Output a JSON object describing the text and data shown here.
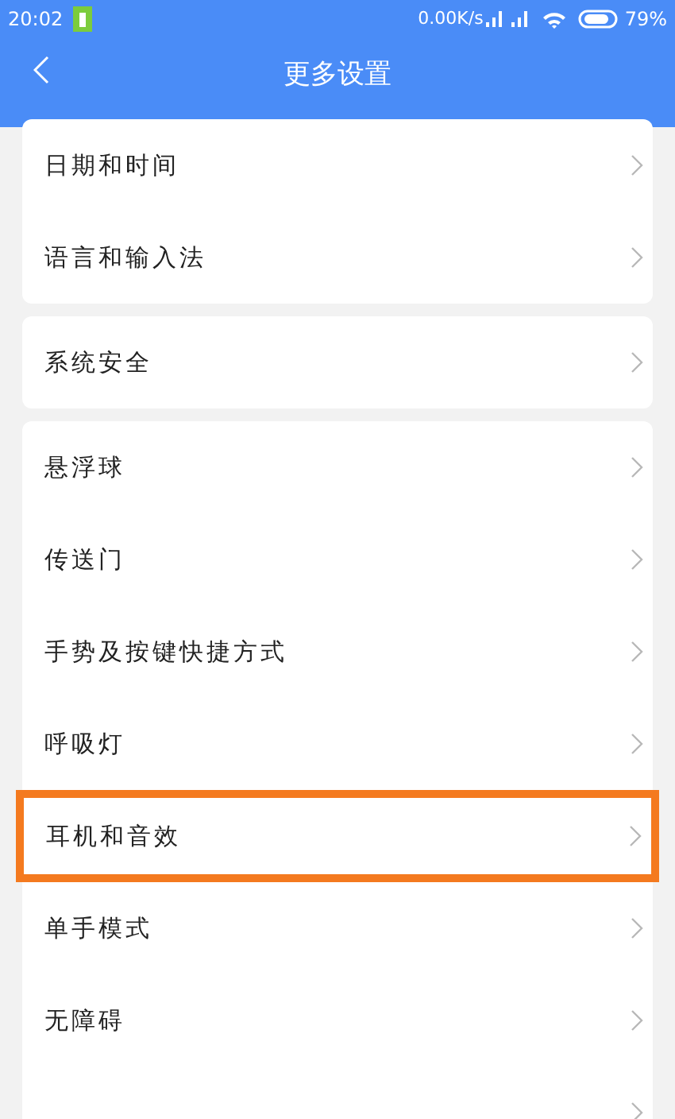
{
  "status_bar": {
    "time": "20:02",
    "speed": "0.00K/s",
    "battery": "79%"
  },
  "header": {
    "title": "更多设置"
  },
  "groups": [
    {
      "items": [
        {
          "label": "日期和时间",
          "highlighted": false
        },
        {
          "label": "语言和输入法",
          "highlighted": false
        }
      ]
    },
    {
      "items": [
        {
          "label": "系统安全",
          "highlighted": false
        }
      ]
    },
    {
      "items": [
        {
          "label": "悬浮球",
          "highlighted": false
        },
        {
          "label": "传送门",
          "highlighted": false
        },
        {
          "label": "手势及按键快捷方式",
          "highlighted": false
        },
        {
          "label": "呼吸灯",
          "highlighted": false
        },
        {
          "label": "耳机和音效",
          "highlighted": true
        },
        {
          "label": "单手模式",
          "highlighted": false
        },
        {
          "label": "无障碍",
          "highlighted": false
        },
        {
          "highlighted": false
        }
      ]
    }
  ]
}
